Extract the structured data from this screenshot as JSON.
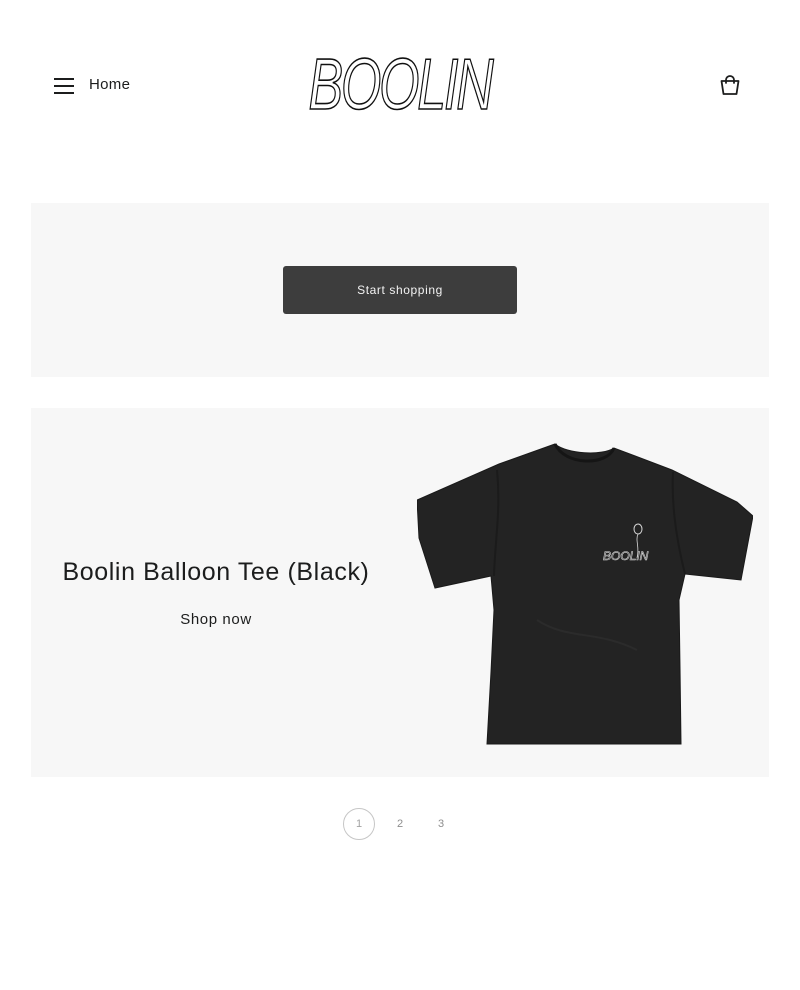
{
  "header": {
    "menu_icon": "hamburger-icon",
    "home_label": "Home",
    "logo_text": "BOOLIN",
    "cart_icon": "shopping-bag-icon"
  },
  "hero": {
    "cta_label": "Start shopping"
  },
  "featured": {
    "title": "Boolin Balloon Tee (Black)",
    "link_label": "Shop now",
    "image_icon": "black-tshirt-image",
    "shirt_print": "BOOLIN"
  },
  "pagination": {
    "pages": [
      "1",
      "2",
      "3"
    ],
    "active": "1"
  },
  "colors": {
    "text": "#1c1d1d",
    "button": "#3d3d3d",
    "panel": "#f7f7f7",
    "shirt": "#232323"
  }
}
